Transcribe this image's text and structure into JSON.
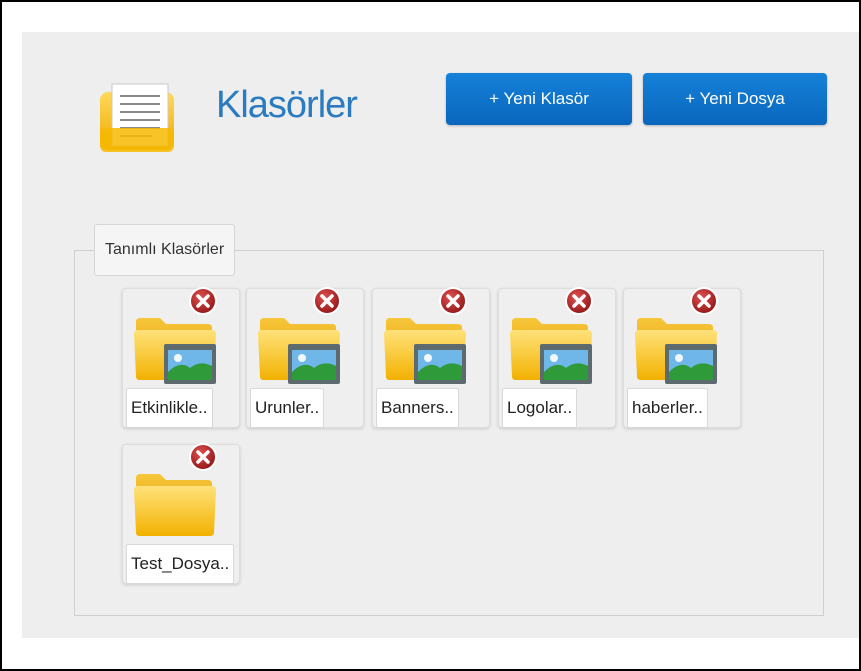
{
  "header": {
    "title": "Klasörler",
    "icon": "documents-folder-icon",
    "new_folder_label": "+ Yeni Klasör",
    "new_file_label": "+ Yeni Dosya"
  },
  "colors": {
    "accent": "#0a6dc7",
    "title": "#2a7bbf",
    "delete": "#b01c1c"
  },
  "folders_section": {
    "legend": "Tanımlı Klasörler",
    "items": [
      {
        "label": "Etkinlikle..",
        "icon": "image-folder-icon"
      },
      {
        "label": "Urunler..",
        "icon": "image-folder-icon"
      },
      {
        "label": "Banners..",
        "icon": "image-folder-icon"
      },
      {
        "label": "Logolar..",
        "icon": "image-folder-icon"
      },
      {
        "label": "haberler..",
        "icon": "image-folder-icon"
      },
      {
        "label": "Test_Dosya..",
        "icon": "folder-icon"
      }
    ]
  }
}
